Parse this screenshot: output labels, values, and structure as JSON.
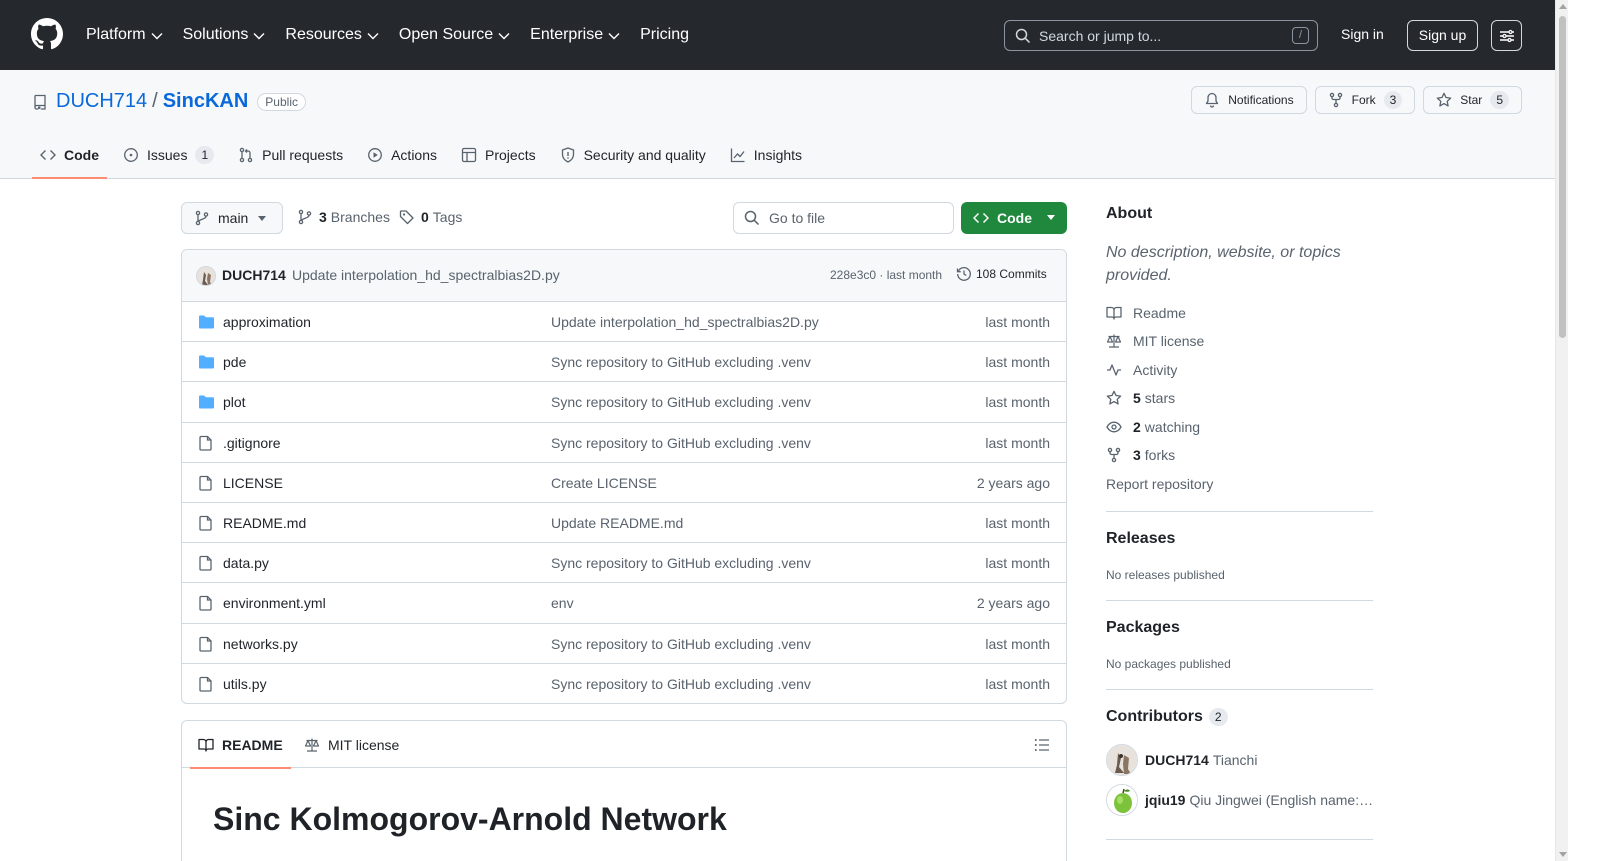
{
  "header": {
    "nav": [
      {
        "label": "Platform",
        "has_dropdown": true
      },
      {
        "label": "Solutions",
        "has_dropdown": true
      },
      {
        "label": "Resources",
        "has_dropdown": true
      },
      {
        "label": "Open Source",
        "has_dropdown": true
      },
      {
        "label": "Enterprise",
        "has_dropdown": true
      },
      {
        "label": "Pricing",
        "has_dropdown": false
      }
    ],
    "search_placeholder": "Search or jump to...",
    "search_shortcut": "/",
    "sign_in": "Sign in",
    "sign_up": "Sign up"
  },
  "repo": {
    "owner": "DUCH714",
    "separator": "/",
    "name": "SincKAN",
    "visibility": "Public",
    "notifications_label": "Notifications",
    "fork_label": "Fork",
    "fork_count": "3",
    "star_label": "Star",
    "star_count": "5",
    "tabs": [
      {
        "label": "Code",
        "icon": "code-icon",
        "active": true
      },
      {
        "label": "Issues",
        "icon": "issue-icon",
        "count": "1"
      },
      {
        "label": "Pull requests",
        "icon": "pull-request-icon"
      },
      {
        "label": "Actions",
        "icon": "play-icon"
      },
      {
        "label": "Projects",
        "icon": "table-icon"
      },
      {
        "label": "Security and quality",
        "icon": "shield-icon"
      },
      {
        "label": "Insights",
        "icon": "graph-icon"
      }
    ]
  },
  "filenav": {
    "branch": "main",
    "branches_count": "3",
    "branches_label": "Branches",
    "tags_count": "0",
    "tags_label": "Tags",
    "goto_placeholder": "Go to file",
    "code_button": "Code"
  },
  "latest_commit": {
    "author": "DUCH714",
    "message": "Update interpolation_hd_spectralbias2D.py",
    "meta": "228e3c0 · last month",
    "commits": "108 Commits"
  },
  "files": [
    {
      "name": "approximation",
      "type": "folder",
      "commit": "Update interpolation_hd_spectralbias2D.py",
      "age": "last month"
    },
    {
      "name": "pde",
      "type": "folder",
      "commit": "Sync repository to GitHub excluding .venv",
      "age": "last month"
    },
    {
      "name": "plot",
      "type": "folder",
      "commit": "Sync repository to GitHub excluding .venv",
      "age": "last month"
    },
    {
      "name": ".gitignore",
      "type": "file",
      "commit": "Sync repository to GitHub excluding .venv",
      "age": "last month"
    },
    {
      "name": "LICENSE",
      "type": "file",
      "commit": "Create LICENSE",
      "age": "2 years ago"
    },
    {
      "name": "README.md",
      "type": "file",
      "commit": "Update README.md",
      "age": "last month"
    },
    {
      "name": "data.py",
      "type": "file",
      "commit": "Sync repository to GitHub excluding .venv",
      "age": "last month"
    },
    {
      "name": "environment.yml",
      "type": "file",
      "commit": "env",
      "age": "2 years ago"
    },
    {
      "name": "networks.py",
      "type": "file",
      "commit": "Sync repository to GitHub excluding .venv",
      "age": "last month"
    },
    {
      "name": "utils.py",
      "type": "file",
      "commit": "Sync repository to GitHub excluding .venv",
      "age": "last month"
    }
  ],
  "readme": {
    "tab_readme": "README",
    "tab_license": "MIT license",
    "heading": "Sinc Kolmogorov-Arnold Network"
  },
  "about": {
    "title": "About",
    "description": "No description, website, or topics provided.",
    "readme": "Readme",
    "license": "MIT license",
    "activity": "Activity",
    "stars_count": "5",
    "stars_label": "stars",
    "watching_count": "2",
    "watching_label": "watching",
    "forks_count": "3",
    "forks_label": "forks",
    "report": "Report repository"
  },
  "releases": {
    "title": "Releases",
    "note": "No releases published"
  },
  "packages": {
    "title": "Packages",
    "note": "No packages published"
  },
  "contributors": {
    "title": "Contributors",
    "count": "2",
    "list": [
      {
        "login": "DUCH714",
        "name": "Tianchi"
      },
      {
        "login": "jqiu19",
        "name": "Qiu Jingwei (English name: …"
      }
    ]
  },
  "colors": {
    "header_bg": "#25292e",
    "link": "#0969da",
    "primary_button": "#1f883d",
    "active_tab_underline": "#fd8c73",
    "folder_icon": "#54aeff"
  }
}
